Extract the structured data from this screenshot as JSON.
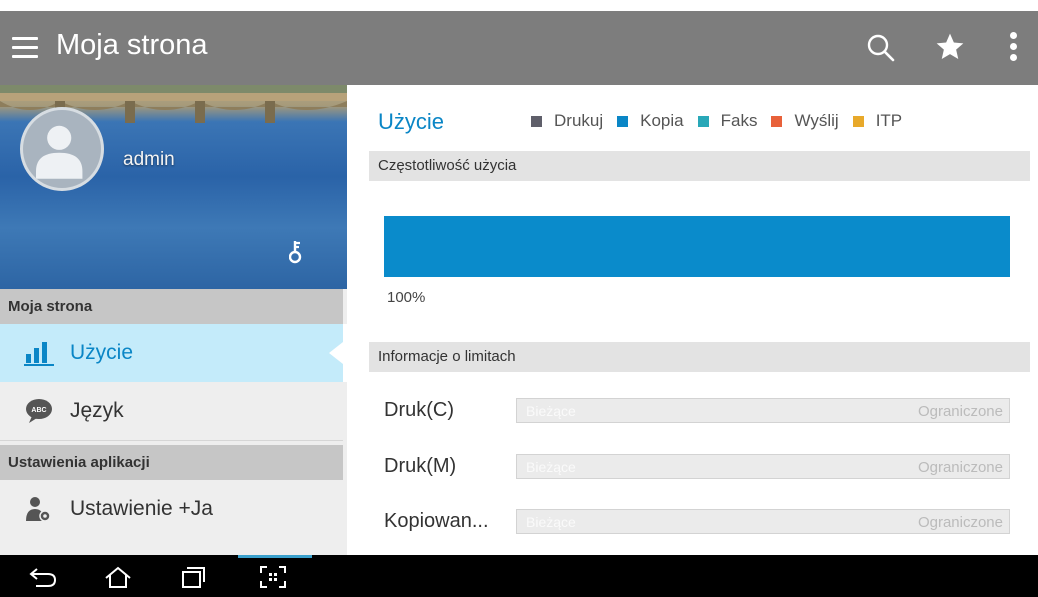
{
  "app_bar": {
    "title": "Moja strona",
    "icons": [
      "menu-icon",
      "search-icon",
      "star-icon",
      "more-vertical-icon"
    ]
  },
  "sidebar": {
    "user": {
      "name": "admin"
    },
    "sections": [
      {
        "header": "Moja strona",
        "items": [
          {
            "label": "Użycie",
            "icon": "bar-chart-icon",
            "active": true
          },
          {
            "label": "Język",
            "icon": "abc-bubble-icon",
            "active": false
          }
        ]
      },
      {
        "header": "Ustawienia aplikacji",
        "items": [
          {
            "label": "Ustawienie +Ja",
            "icon": "person-settings-icon",
            "active": false
          }
        ]
      }
    ]
  },
  "usage": {
    "title": "Użycie",
    "legend": [
      {
        "label": "Drukuj",
        "color": "#5f5f6a"
      },
      {
        "label": "Kopia",
        "color": "#0a86c6"
      },
      {
        "label": "Faks",
        "color": "#29a8b8"
      },
      {
        "label": "Wyślij",
        "color": "#e8613a"
      },
      {
        "label": "ITP",
        "color": "#e8a92a"
      }
    ],
    "frequency": {
      "header": "Częstotliwość użycia",
      "percent_label": "100%",
      "fill_fraction": 1.0,
      "fill_color": "#0a8bcb"
    },
    "limits": {
      "header": "Informacje o limitach",
      "rows": [
        {
          "label": "Druk(C)",
          "current": "Bieżące",
          "max": "Ograniczone"
        },
        {
          "label": "Druk(M)",
          "current": "Bieżące",
          "max": "Ograniczone"
        },
        {
          "label": "Kopiowan...",
          "current": "Bieżące",
          "max": "Ograniczone"
        }
      ]
    }
  },
  "system_nav": {
    "buttons": [
      "back-icon",
      "home-icon",
      "recent-apps-icon",
      "screen-capture-icon"
    ]
  }
}
